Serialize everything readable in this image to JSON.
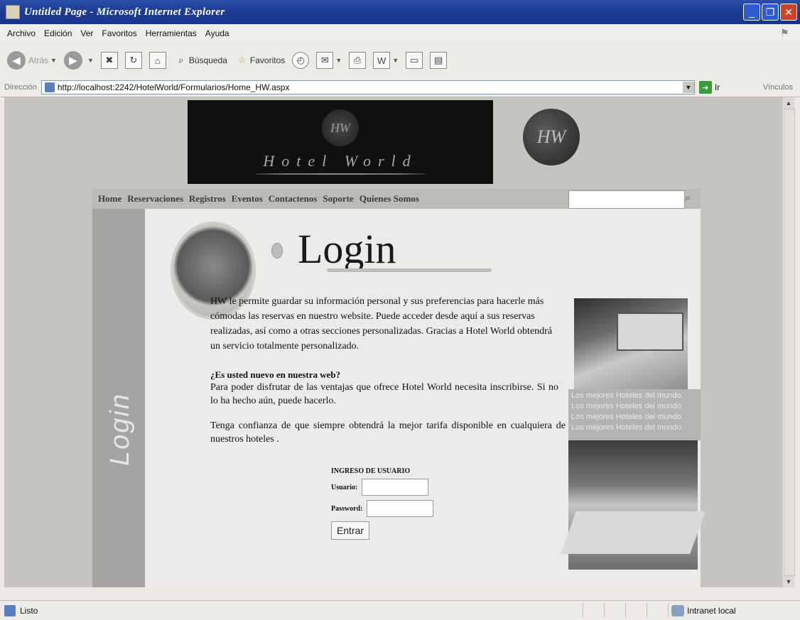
{
  "window": {
    "title": "Untitled Page - Microsoft Internet Explorer"
  },
  "menubar": {
    "items": [
      "Archivo",
      "Edición",
      "Ver",
      "Favoritos",
      "Herramientas",
      "Ayuda"
    ]
  },
  "toolbar": {
    "back": "Atrás",
    "search": "Búsqueda",
    "favorites": "Favoritos"
  },
  "address": {
    "label": "Dirección",
    "url": "http://localhost:2242/HotelWorld/Formularios/Home_HW.aspx",
    "go": "Ir",
    "links": "Vínculos"
  },
  "banner": {
    "monogram": "HW",
    "brand": "Hotel World"
  },
  "nav": {
    "items": [
      "Home",
      "Reservaciones",
      "Registros",
      "Eventos",
      "Contactenos",
      "Soporte",
      "Quienes Somos"
    ],
    "search_placeholder": ""
  },
  "page": {
    "side_label": "Login",
    "title": "Login",
    "intro": "HW le permite guardar su información personal y sus preferencias para hacerle más cómodas las reservas en nuestro website. Puede acceder desde aquí a sus reservas realizadas, así como a otras secciones personalizadas. Gracias a Hotel World obtendrá un servicio totalmente personalizado.",
    "new_heading": "¿Es usted nuevo en nuestra web?",
    "new_text": "Para poder disfrutar de las ventajas que ofrece Hotel World necesita inscribirse. Si no lo ha hecho aún, puede hacerlo.",
    "confidence": "Tenga confianza de que siempre obtendrá la mejor tarifa disponible en cualquiera de nuestros hoteles .",
    "overlay_text": "Los mejores Hoteles del mundo. Los mejores Hoteles del mundo. Los mejores Hoteles del mundo. Los mejores Hoteles del mundo."
  },
  "login_form": {
    "title": "INGRESO DE USUARIO",
    "user_label": "Usuario:",
    "password_label": "Password:",
    "user_value": "",
    "password_value": "",
    "submit": "Entrar"
  },
  "status": {
    "text": "Listo",
    "zone": "Intranet local"
  }
}
